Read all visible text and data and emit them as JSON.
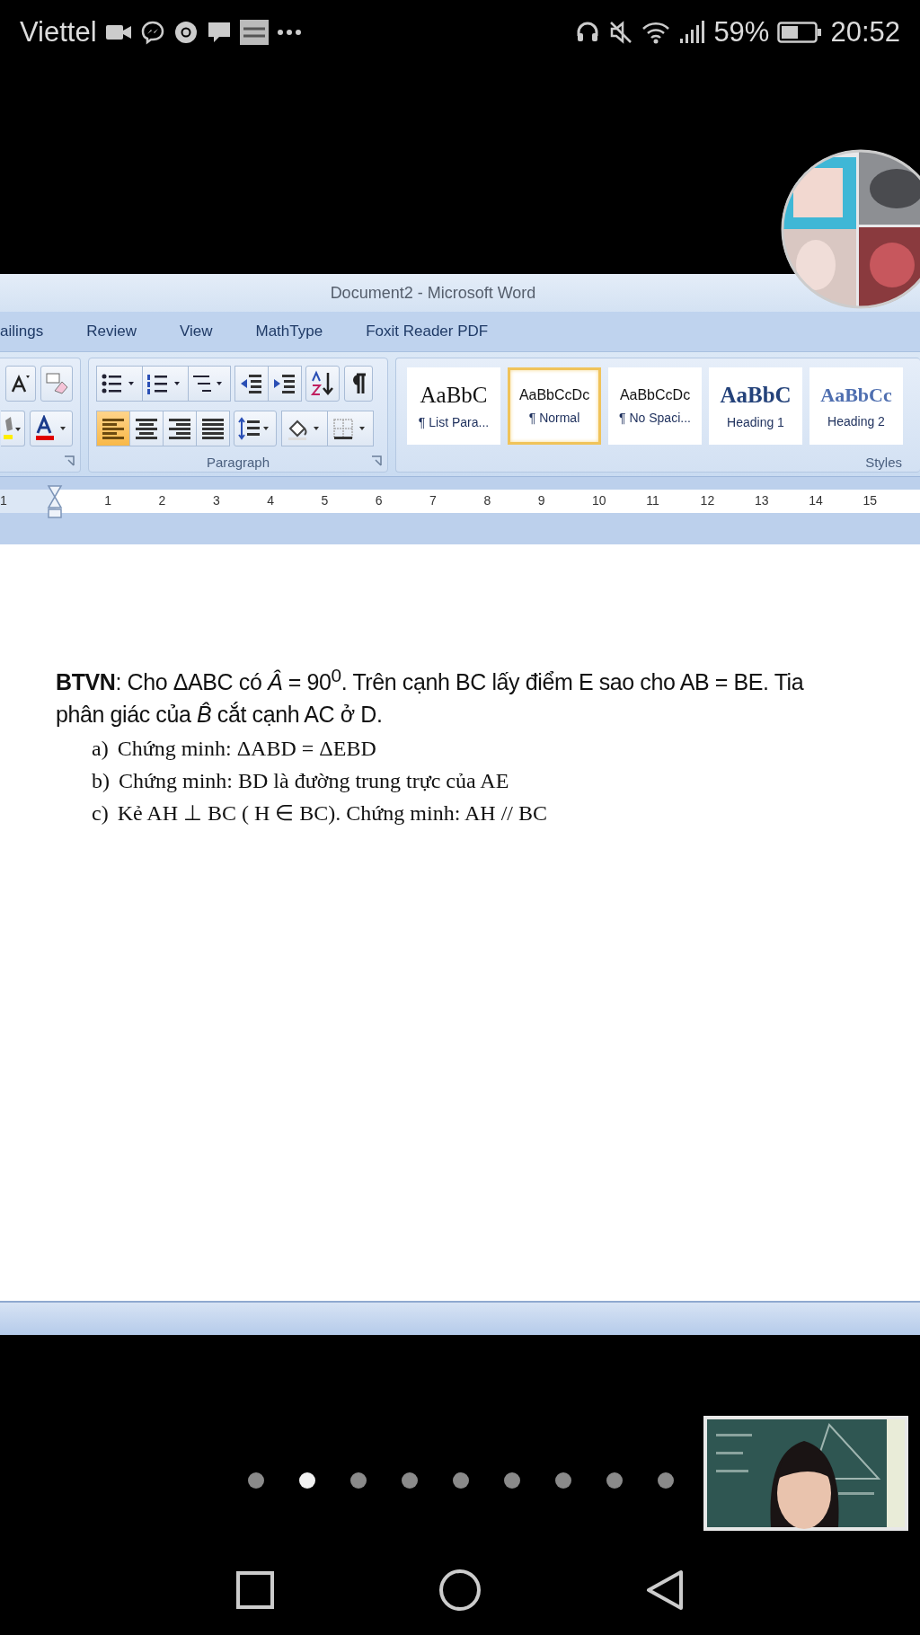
{
  "status_bar": {
    "carrier": "Viettel",
    "battery_percent": "59%",
    "time": "20:52"
  },
  "word": {
    "title": "Document2 - Microsoft Word",
    "tabs": [
      "ailings",
      "Review",
      "View",
      "MathType",
      "Foxit Reader PDF"
    ],
    "paragraph_group": {
      "label": "Paragraph",
      "alignment": [
        {
          "kind": "left",
          "selected": true
        },
        {
          "kind": "center",
          "selected": false
        },
        {
          "kind": "right",
          "selected": false
        },
        {
          "kind": "justify",
          "selected": false
        }
      ]
    },
    "styles_group": {
      "label": "Styles",
      "styles": [
        {
          "sample": "AaBbC",
          "name": "¶ List Para...",
          "kind": "serif",
          "selected": false
        },
        {
          "sample": "AaBbCcDc",
          "name": "¶ Normal",
          "kind": "sans",
          "selected": true
        },
        {
          "sample": "AaBbCcDc",
          "name": "¶ No Spaci...",
          "kind": "sans",
          "selected": false
        },
        {
          "sample": "AaBbC",
          "name": "Heading 1",
          "kind": "heading1",
          "selected": false
        },
        {
          "sample": "AaBbCc",
          "name": "Heading 2",
          "kind": "heading2",
          "selected": false
        }
      ]
    },
    "ruler_numbers": [
      "1",
      "1",
      "2",
      "3",
      "4",
      "5",
      "6",
      "7",
      "8",
      "9",
      "10",
      "11",
      "12",
      "13",
      "14",
      "15"
    ],
    "document": {
      "paragraph_lines": [
        "**BTVN**: Cho ΔABC có *Â* = 90$^{0}$. Trên cạnh BC lấy điểm E sao cho AB = BE. Tia",
        "phân giác của *B̂* cắt cạnh AC ở D."
      ],
      "items": [
        {
          "marker": "a)",
          "text": "Chứng minh: ΔABD = ΔEBD"
        },
        {
          "marker": "b)",
          "text": "Chứng minh: BD là đường trung trực của AE"
        },
        {
          "marker": "c)",
          "text": "Kẻ AH ⊥ BC ( H ∈ BC). Chứng minh: AH // BC"
        }
      ]
    }
  },
  "page_dots": [
    {
      "selected": false
    },
    {
      "selected": true
    },
    {
      "selected": false
    },
    {
      "selected": false
    },
    {
      "selected": false
    },
    {
      "selected": false
    },
    {
      "selected": false
    },
    {
      "selected": false
    },
    {
      "selected": false
    }
  ]
}
